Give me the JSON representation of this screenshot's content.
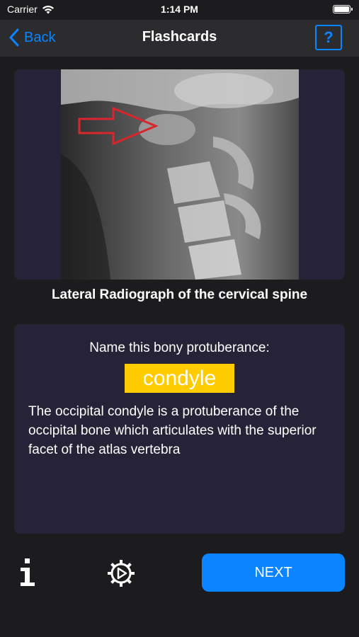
{
  "status_bar": {
    "carrier": "Carrier",
    "time": "1:14 PM"
  },
  "nav": {
    "back_label": "Back",
    "title": "Flashcards",
    "help_label": "?"
  },
  "card": {
    "image_caption": "Lateral Radiograph of the cervical spine",
    "prompt": "Name this bony protuberance:",
    "answer": "condyle",
    "explanation": "The occipital condyle is a protuberance of the occipital bone which articulates  with the superior facet of the atlas vertebra"
  },
  "toolbar": {
    "next_label": "NEXT"
  },
  "icons": {
    "wifi": "wifi-icon",
    "battery": "battery-icon",
    "back": "chevron-left-icon",
    "info": "info-icon",
    "settings": "gear-icon"
  },
  "colors": {
    "accent": "#0a84ff",
    "card_background": "#262338",
    "answer_highlight": "#ffcc00",
    "arrow": "#d8262c",
    "background": "#1c1c1e"
  }
}
